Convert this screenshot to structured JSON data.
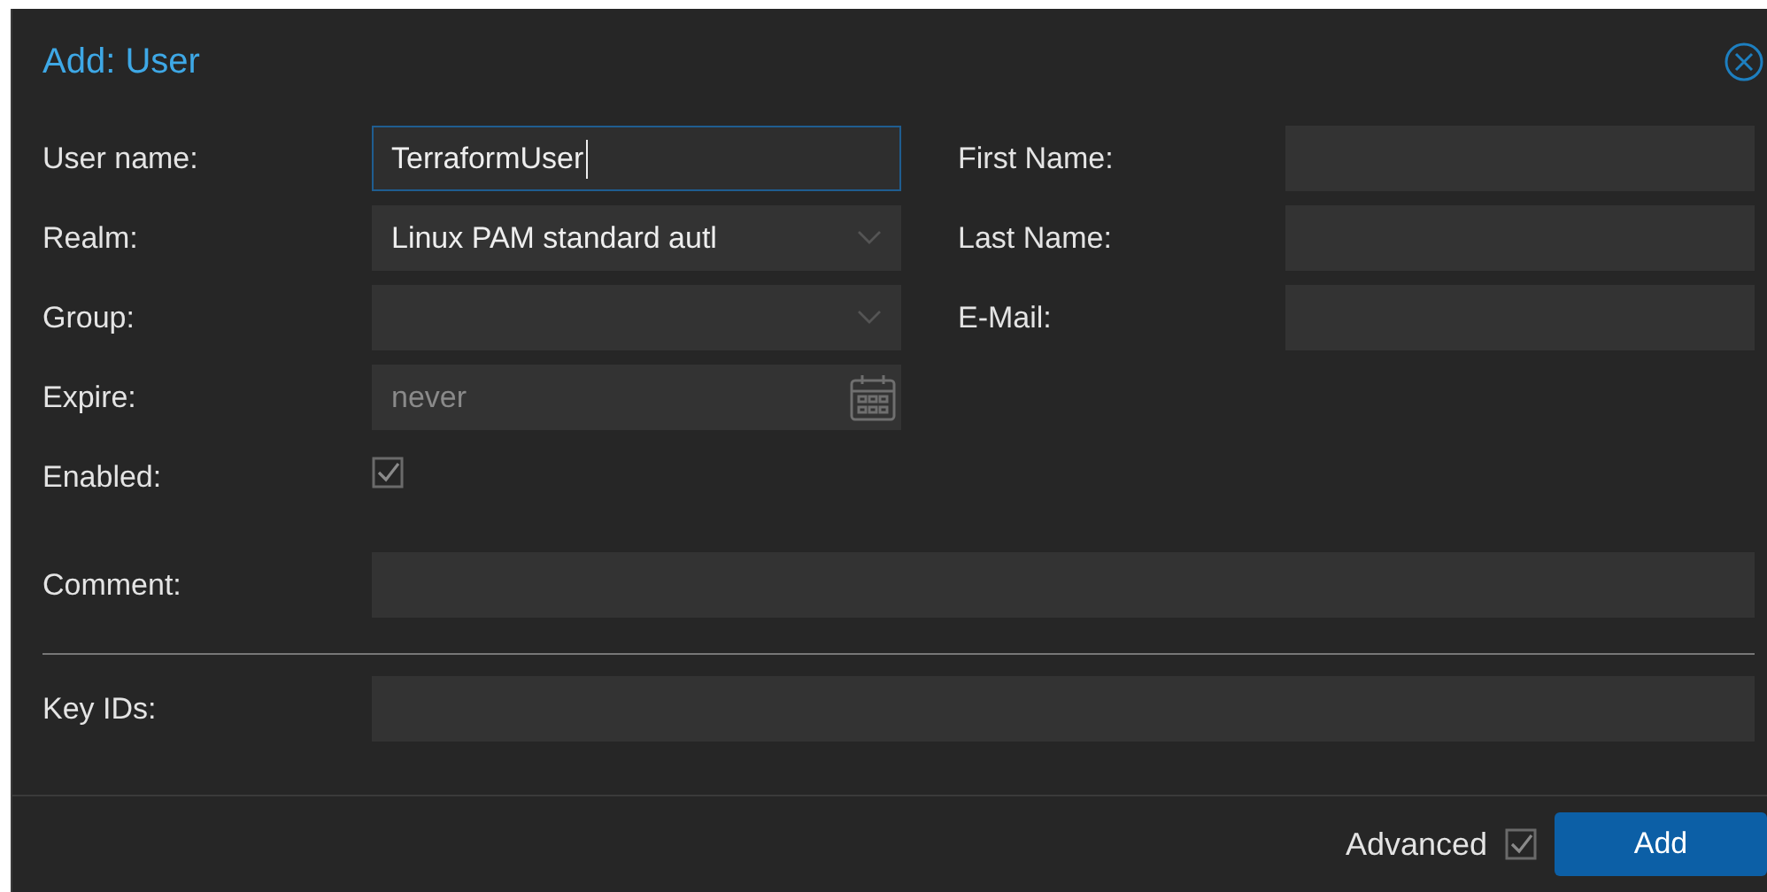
{
  "window": {
    "title": "Add: User"
  },
  "left_fields": [
    {
      "kind": "text",
      "label": "User name:",
      "value": "TerraformUser",
      "focused": true
    },
    {
      "kind": "combo",
      "label": "Realm:",
      "value": "Linux PAM standard autl",
      "focused": false
    },
    {
      "kind": "combo",
      "label": "Group:",
      "focused": false
    },
    {
      "kind": "date",
      "label": "Expire:",
      "placeholder": "never",
      "focused": false
    },
    {
      "kind": "checkbox",
      "label": "Enabled:",
      "checked": true
    }
  ],
  "right_fields": [
    {
      "kind": "text",
      "label": "First Name:",
      "focused": false
    },
    {
      "kind": "text",
      "label": "Last Name:",
      "focused": false
    },
    {
      "kind": "text",
      "label": "E-Mail:",
      "focused": false
    }
  ],
  "comment": {
    "label": "Comment:"
  },
  "key_ids": {
    "label": "Key IDs:"
  },
  "footer": {
    "advanced": {
      "label": "Advanced",
      "checked": true
    },
    "button": "Add"
  }
}
